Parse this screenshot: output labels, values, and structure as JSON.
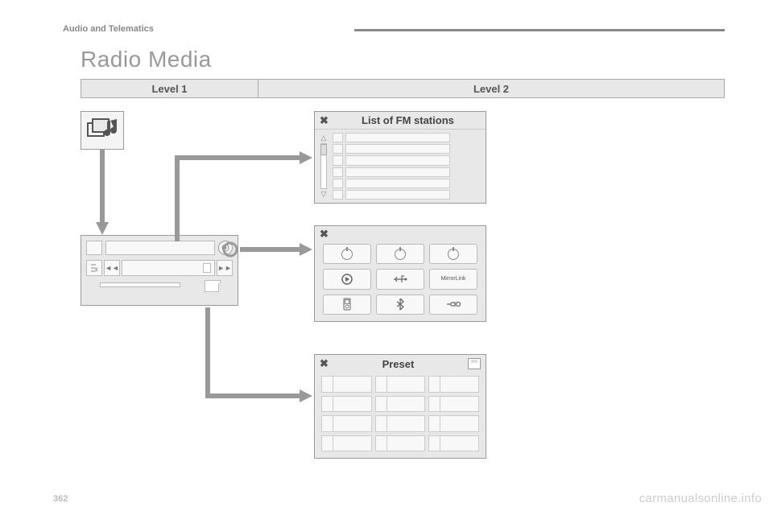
{
  "header": {
    "section": "Audio and Telematics",
    "title": "Radio Media",
    "page_num": "362"
  },
  "levels": {
    "col1": "Level 1",
    "col2": "Level 2"
  },
  "fm_panel": {
    "title": "List of FM stations",
    "rows": 6
  },
  "sources_panel": {
    "items": [
      {
        "name": "radio-fm-icon",
        "label": ""
      },
      {
        "name": "radio-am-icon",
        "label": ""
      },
      {
        "name": "radio-dab-icon",
        "label": ""
      },
      {
        "name": "play-disc-icon",
        "label": ""
      },
      {
        "name": "usb-icon",
        "label": ""
      },
      {
        "name": "mirrorlink-icon",
        "label": "MirrorLink"
      },
      {
        "name": "ipod-icon",
        "label": ""
      },
      {
        "name": "bluetooth-icon",
        "label": ""
      },
      {
        "name": "aux-icon",
        "label": ""
      }
    ]
  },
  "preset_panel": {
    "title": "Preset",
    "slots": 12
  },
  "watermark": "carmanualsonline.info"
}
